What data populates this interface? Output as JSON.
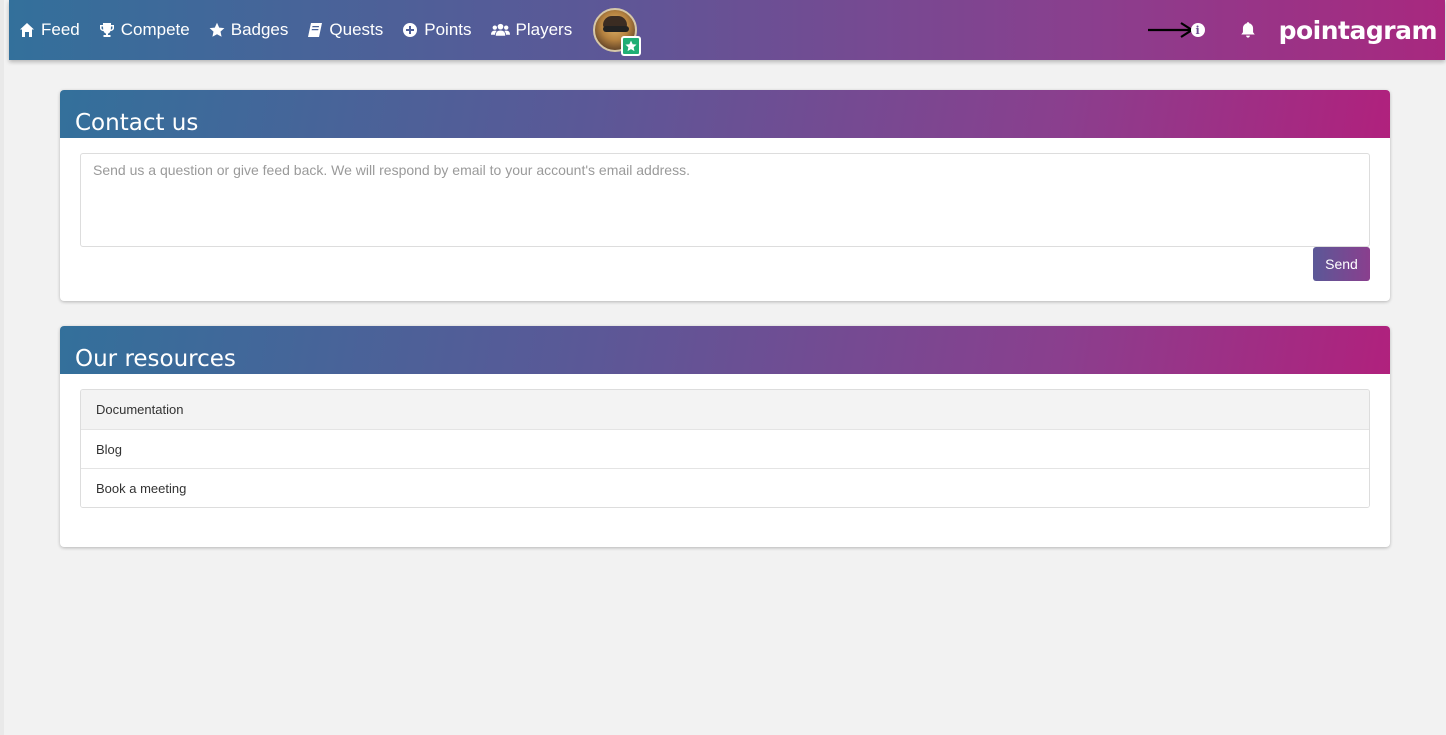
{
  "nav": {
    "items": [
      {
        "label": "Feed",
        "icon": "home-icon"
      },
      {
        "label": "Compete",
        "icon": "trophy-icon"
      },
      {
        "label": "Badges",
        "icon": "star-icon"
      },
      {
        "label": "Quests",
        "icon": "book-icon"
      },
      {
        "label": "Points",
        "icon": "plus-circle-icon"
      },
      {
        "label": "Players",
        "icon": "users-icon"
      }
    ],
    "brand": "pointagram"
  },
  "contact": {
    "title": "Contact us",
    "placeholder": "Send us a question or give feed back. We will respond by email to your account's email address.",
    "send_label": "Send"
  },
  "resources": {
    "title": "Our resources",
    "items": [
      "Documentation",
      "Blog",
      "Book a meeting"
    ]
  },
  "colors": {
    "gradient_start": "#33709b",
    "gradient_end": "#a8287f",
    "badge": "#1fae74"
  }
}
